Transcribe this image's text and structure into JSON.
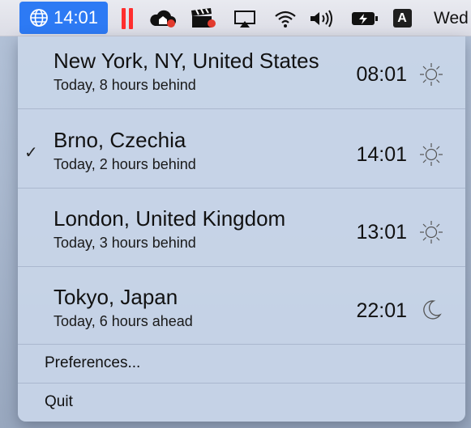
{
  "menubar": {
    "clock_time": "14:01",
    "input_badge": "A",
    "day_label": "Wed"
  },
  "cities": [
    {
      "name": "New York, NY, United States",
      "detail": "Today, 8 hours behind",
      "time": "08:01",
      "icon": "sun-icon",
      "checked": false
    },
    {
      "name": "Brno, Czechia",
      "detail": "Today, 2 hours behind",
      "time": "14:01",
      "icon": "sun-icon",
      "checked": true
    },
    {
      "name": "London, United Kingdom",
      "detail": "Today, 3 hours behind",
      "time": "13:01",
      "icon": "sun-icon",
      "checked": false
    },
    {
      "name": "Tokyo, Japan",
      "detail": "Today, 6 hours ahead",
      "time": "22:01",
      "icon": "moon-icon",
      "checked": false
    }
  ],
  "check_mark": "✓",
  "menu": {
    "preferences_label": "Preferences...",
    "quit_label": "Quit"
  },
  "colors": {
    "clock_highlight": "#2d7af4",
    "pause_red": "#ff2e2e"
  }
}
